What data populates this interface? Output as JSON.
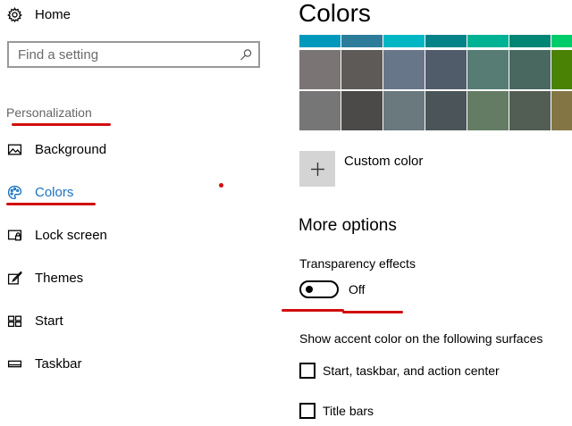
{
  "sidebar": {
    "home_label": "Home",
    "search_placeholder": "Find a setting",
    "section_label": "Personalization",
    "items": [
      {
        "label": "Background",
        "icon": "picture-icon"
      },
      {
        "label": "Colors",
        "icon": "palette-icon",
        "active": true
      },
      {
        "label": "Lock screen",
        "icon": "lock-screen-icon"
      },
      {
        "label": "Themes",
        "icon": "brush-icon"
      },
      {
        "label": "Start",
        "icon": "start-grid-icon"
      },
      {
        "label": "Taskbar",
        "icon": "taskbar-icon"
      }
    ]
  },
  "main": {
    "title": "Colors",
    "swatch_rows": [
      [
        "#0099bc",
        "#2d7d9a",
        "#00b7c3",
        "#038387",
        "#00b294",
        "#018574",
        "#00cc6a"
      ],
      [
        "#7a7574",
        "#5d5a58",
        "#68768a",
        "#515c6b",
        "#567c73",
        "#486860",
        "#498205"
      ],
      [
        "#767676",
        "#4c4a48",
        "#69797e",
        "#4a5459",
        "#647c64",
        "#525e54",
        "#847545"
      ]
    ],
    "custom_color_label": "Custom color",
    "more_options_heading": "More options",
    "transparency_label": "Transparency effects",
    "transparency_state": "Off",
    "accent_surfaces_label": "Show accent color on the following surfaces",
    "checkboxes": [
      {
        "label": "Start, taskbar, and action center",
        "checked": false
      },
      {
        "label": "Title bars",
        "checked": false
      }
    ]
  },
  "colors": {
    "accent": "#1b73c0",
    "annotation_red": "#d20e0e"
  }
}
